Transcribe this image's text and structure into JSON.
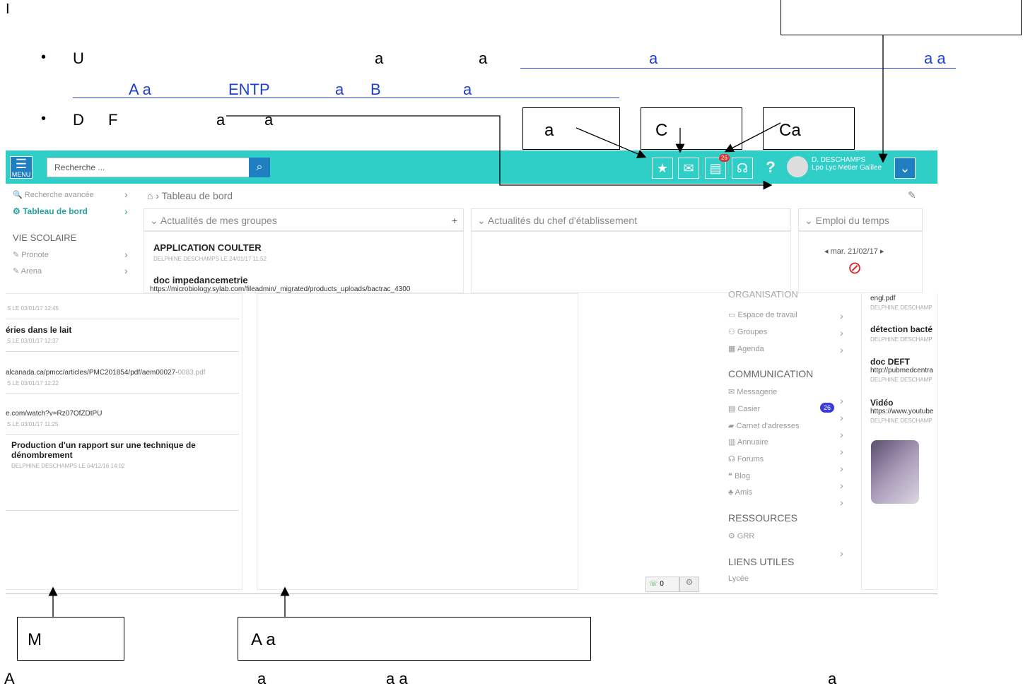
{
  "doc": {
    "top_letter": "I",
    "bullet1": {
      "part1": "U",
      "part2": "a",
      "part3": "a",
      "link1": "a",
      "link2": "a a",
      "line2a": "A a",
      "line2b": "ENTP",
      "line2c": "a",
      "line2d": "B",
      "line2e": "a"
    },
    "bullet2": {
      "part1": "D",
      "part2": "F",
      "part3": "a",
      "part4": "a"
    },
    "callouts": {
      "fav": "a",
      "mail": "C",
      "casier": "Ca",
      "bottom_left": "M",
      "bottom_mid": "A a"
    },
    "footer": {
      "t1": "A",
      "t2": "a",
      "t3": "a a",
      "t4": "a"
    }
  },
  "app": {
    "search_placeholder": "Recherche ...",
    "menu_label": "MENU",
    "casier_badge": "26",
    "user_name": "D. DESCHAMPS",
    "user_school": "Lpo Lyc Metier Galilee",
    "sidebar": {
      "adv_search": "Recherche avancée",
      "dashboard": "Tableau de bord",
      "vie_scolaire": "VIE SCOLAIRE",
      "pronote": "Pronote",
      "arena": "Arena"
    },
    "breadcrumb": "› Tableau de bord",
    "panels": {
      "groups": "Actualités de mes groupes",
      "chef": "Actualités du chef d'établissement",
      "edt": "Emploi du temps",
      "edt_date": "mar. 21/02/17"
    },
    "posts": [
      {
        "title": "APPLICATION COULTER",
        "meta": "DELPHINE DESCHAMPS LE 24/01/17 11:52"
      },
      {
        "title": "doc impedancemetrie",
        "url": "https://microbiology.sylab.com/fileadmin/_migrated/products_uploads/bactrac_4300"
      }
    ],
    "lower_posts": [
      {
        "meta": "S LE 03/01/17 12:45"
      },
      {
        "title": "éries dans le lait",
        "meta": "S LE 03/01/17 12:37"
      },
      {
        "url": "alcanada.ca/pmcc/articles/PMC201854/pdf/aem00027-",
        "url_tail": "0083.pdf",
        "meta": "S LE 03/01/17 12:22"
      },
      {
        "url": "e.com/watch?v=Rz07OfZDtPU",
        "meta": "S LE 03/01/17 11:25"
      },
      {
        "title": "Production d'un rapport sur une technique de dénombrement",
        "meta": "DELPHINE DESCHAMPS LE 04/12/16 14:02"
      }
    ],
    "menu": {
      "org_header": "ORGANISATION",
      "items_org": [
        "Espace de travail",
        "Groupes",
        "Agenda"
      ],
      "comm_header": "COMMUNICATION",
      "items_comm": [
        "Messagerie",
        "Casier",
        "Carnet d'adresses",
        "Annuaire",
        "Forums",
        "Blog",
        "Amis"
      ],
      "casier_count": "26",
      "res_header": "RESSOURCES",
      "items_res": [
        "GRR"
      ],
      "liens_header": "LIENS UTILES",
      "items_liens": [
        "Lycée"
      ]
    },
    "right_posts": [
      {
        "title": "",
        "meta": "DELPHINE DESCHAMP",
        "url": "engl.pdf"
      },
      {
        "title": "détection bacté",
        "meta": "DELPHINE DESCHAMP"
      },
      {
        "title": "doc DEFT",
        "url": "http://pubmedcentra",
        "meta": "DELPHINE DESCHAMP"
      },
      {
        "title": "Vidéo",
        "url": "https://www.youtube",
        "meta": "DELPHINE DESCHAMP"
      }
    ],
    "chat_count": "0"
  }
}
